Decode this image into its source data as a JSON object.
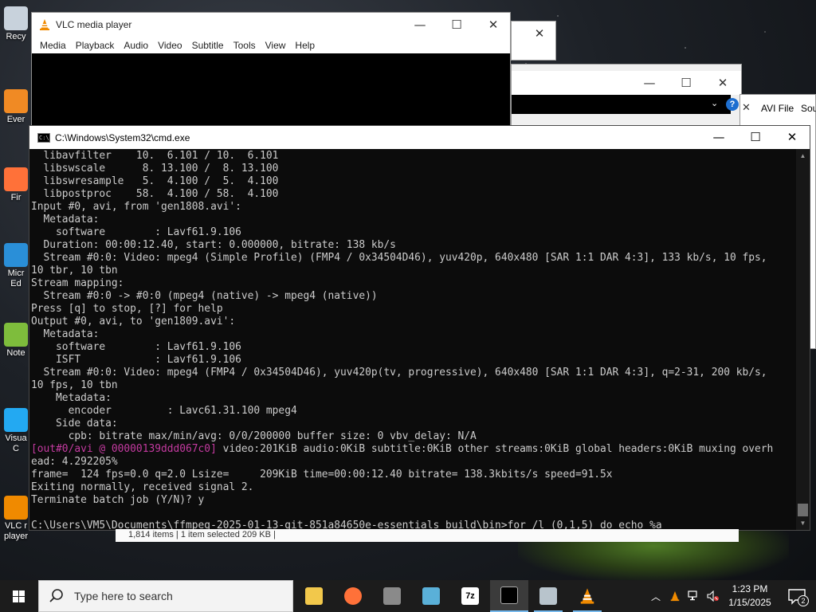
{
  "desktop": {
    "icons": [
      {
        "label": "Recy",
        "icon": "recycle-bin-icon",
        "color": "#c8d2dc"
      },
      {
        "label": "Ever",
        "icon": "everything-search-icon",
        "color": "#f08a24"
      },
      {
        "label": "Fir",
        "icon": "firefox-icon",
        "color": "#ff7139"
      },
      {
        "label": "Micr\nEd",
        "icon": "edge-icon",
        "color": "#2a8fd8"
      },
      {
        "label": "Note",
        "icon": "notepad-plus-plus-icon",
        "color": "#7ebd3c"
      },
      {
        "label": "Visua\nC",
        "icon": "vscode-icon",
        "color": "#23a9f2"
      },
      {
        "label": "VLC r\nplayer",
        "icon": "vlc-icon",
        "color": "#f08a00"
      }
    ]
  },
  "background_windows": {
    "explorer": {
      "tabs": [
        "AVI File",
        "Sou"
      ],
      "help_label": "?",
      "status_text": "1,814 items  |  1 item selected  209 KB  |"
    }
  },
  "vlc": {
    "title": "VLC media player",
    "menu": [
      "Media",
      "Playback",
      "Audio",
      "Video",
      "Subtitle",
      "Tools",
      "View",
      "Help"
    ],
    "controls": {
      "minimize": "—",
      "maximize": "☐",
      "close": "✕"
    }
  },
  "cmd": {
    "title": "C:\\Windows\\System32\\cmd.exe",
    "controls": {
      "minimize": "—",
      "maximize": "☐",
      "close": "✕"
    },
    "lines": [
      {
        "t": "  libavfilter    10.  6.101 / 10.  6.101"
      },
      {
        "t": "  libswscale      8. 13.100 /  8. 13.100"
      },
      {
        "t": "  libswresample   5.  4.100 /  5.  4.100"
      },
      {
        "t": "  libpostproc    58.  4.100 / 58.  4.100"
      },
      {
        "t": "Input #0, avi, from 'gen1808.avi':"
      },
      {
        "t": "  Metadata:"
      },
      {
        "t": "    software        : Lavf61.9.106"
      },
      {
        "t": "  Duration: 00:00:12.40, start: 0.000000, bitrate: 138 kb/s"
      },
      {
        "t": "  Stream #0:0: Video: mpeg4 (Simple Profile) (FMP4 / 0x34504D46), yuv420p, 640x480 [SAR 1:1 DAR 4:3], 133 kb/s, 10 fps,"
      },
      {
        "t": "10 tbr, 10 tbn"
      },
      {
        "t": "Stream mapping:"
      },
      {
        "t": "  Stream #0:0 -> #0:0 (mpeg4 (native) -> mpeg4 (native))"
      },
      {
        "t": "Press [q] to stop, [?] for help"
      },
      {
        "t": "Output #0, avi, to 'gen1809.avi':"
      },
      {
        "t": "  Metadata:"
      },
      {
        "t": "    software        : Lavf61.9.106"
      },
      {
        "t": "    ISFT            : Lavf61.9.106"
      },
      {
        "t": "  Stream #0:0: Video: mpeg4 (FMP4 / 0x34504D46), yuv420p(tv, progressive), 640x480 [SAR 1:1 DAR 4:3], q=2-31, 200 kb/s,"
      },
      {
        "t": "10 fps, 10 tbn"
      },
      {
        "t": "    Metadata:"
      },
      {
        "t": "      encoder         : Lavc61.31.100 mpeg4"
      },
      {
        "t": "    Side data:"
      },
      {
        "t": "      cpb: bitrate max/min/avg: 0/0/200000 buffer size: 0 vbv_delay: N/A"
      },
      {
        "m": "[out#0/avi @ 00000139ddd067c0]",
        "t": " video:201KiB audio:0KiB subtitle:0KiB other streams:0KiB global headers:0KiB muxing overh"
      },
      {
        "t": "ead: 4.292205%"
      },
      {
        "t": "frame=  124 fps=0.0 q=2.0 Lsize=     209KiB time=00:00:12.40 bitrate= 138.3kbits/s speed=91.5x"
      },
      {
        "t": "Exiting normally, received signal 2."
      },
      {
        "t": "Terminate batch job (Y/N)? y"
      },
      {
        "t": ""
      },
      {
        "t": "C:\\Users\\VM5\\Documents\\ffmpeg-2025-01-13-git-851a84650e-essentials_build\\bin>for /l (0,1,5) do echo %a"
      }
    ]
  },
  "taskbar": {
    "search_placeholder": "Type here to search",
    "apps": [
      {
        "name": "taskbar-file-explorer",
        "icon": "folder-icon",
        "color": "#f2c84b",
        "active": false,
        "open": false
      },
      {
        "name": "taskbar-firefox",
        "icon": "firefox-icon",
        "color": "#ff7139",
        "active": false,
        "open": false
      },
      {
        "name": "taskbar-app-3",
        "icon": "app-icon",
        "color": "#8a8a8a",
        "active": false,
        "open": false
      },
      {
        "name": "taskbar-app-4",
        "icon": "app-icon",
        "color": "#5ab0d8",
        "active": false,
        "open": false
      },
      {
        "name": "taskbar-7zip",
        "icon": "7zip-icon",
        "color": "#ffffff",
        "label": "7z",
        "active": false,
        "open": false
      },
      {
        "name": "taskbar-cmd",
        "icon": "cmd-icon",
        "color": "#000000",
        "active": true,
        "open": true
      },
      {
        "name": "taskbar-app-7",
        "icon": "app-icon",
        "color": "#b8c4cc",
        "active": false,
        "open": true
      },
      {
        "name": "taskbar-vlc",
        "icon": "vlc-icon",
        "color": "#f08a00",
        "active": false,
        "open": true
      }
    ],
    "clock": {
      "time": "1:23 PM",
      "date": "1/15/2025"
    },
    "notifications_count": "2"
  }
}
